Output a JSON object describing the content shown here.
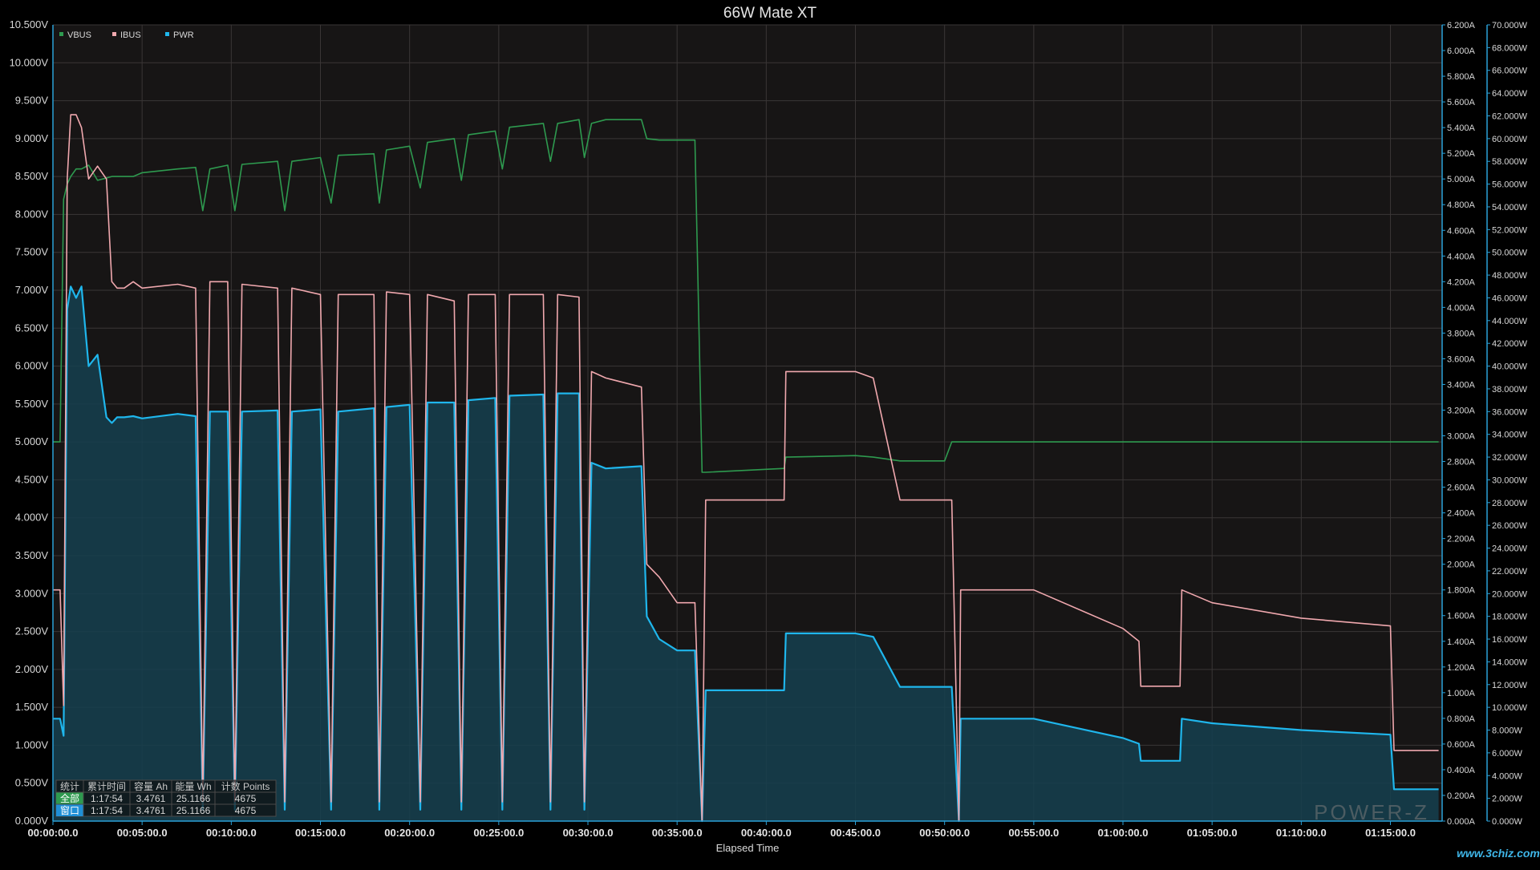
{
  "chart_data": {
    "type": "line",
    "title": "66W Mate XT",
    "xlabel": "Elapsed Time",
    "x_unit": "minutes",
    "xlim": [
      0,
      77.9
    ],
    "x_ticks": [
      0,
      5,
      10,
      15,
      20,
      25,
      30,
      35,
      40,
      45,
      50,
      55,
      60,
      65,
      70,
      75
    ],
    "x_tick_labels": [
      "00:00:00.0",
      "00:05:00.0",
      "00:10:00.0",
      "00:15:00.0",
      "00:20:00.0",
      "00:25:00.0",
      "00:30:00.0",
      "00:35:00.0",
      "00:40:00.0",
      "00:45:00.0",
      "00:50:00.0",
      "00:55:00.0",
      "01:00:00.0",
      "01:05:00.0",
      "01:10:00.0",
      "01:15:00.0"
    ],
    "grid": true,
    "legend_position": "top-left",
    "axes": {
      "voltage": {
        "side": "left",
        "min": 0,
        "max": 10.5,
        "step": 0.5,
        "unit": "V",
        "decimals": 3,
        "tick_labels": [
          "0.000V",
          "0.500V",
          "1.000V",
          "1.500V",
          "2.000V",
          "2.500V",
          "3.000V",
          "3.500V",
          "4.000V",
          "4.500V",
          "5.000V",
          "5.500V",
          "6.000V",
          "6.500V",
          "7.000V",
          "7.500V",
          "8.000V",
          "8.500V",
          "9.000V",
          "9.500V",
          "10.000V",
          "10.500V"
        ]
      },
      "current": {
        "side": "right",
        "min": 0,
        "max": 6.2,
        "step": 0.2,
        "unit": "A",
        "decimals": 3,
        "tick_labels": [
          "0.000A",
          "0.200A",
          "0.400A",
          "0.600A",
          "0.800A",
          "1.000A",
          "1.200A",
          "1.400A",
          "1.600A",
          "1.800A",
          "2.000A",
          "2.200A",
          "2.400A",
          "2.600A",
          "2.800A",
          "3.000A",
          "3.200A",
          "3.400A",
          "3.600A",
          "3.800A",
          "4.000A",
          "4.200A",
          "4.400A",
          "4.600A",
          "4.800A",
          "5.000A",
          "5.200A",
          "5.400A",
          "5.600A",
          "5.800A",
          "6.000A",
          "6.200A"
        ]
      },
      "power": {
        "side": "right",
        "min": 0,
        "max": 70,
        "step": 2,
        "unit": "W",
        "decimals": 3,
        "tick_labels": [
          "0.000W",
          "2.000W",
          "4.000W",
          "6.000W",
          "8.000W",
          "10.000W",
          "12.000W",
          "14.000W",
          "16.000W",
          "18.000W",
          "20.000W",
          "22.000W",
          "24.000W",
          "26.000W",
          "28.000W",
          "30.000W",
          "32.000W",
          "34.000W",
          "36.000W",
          "38.000W",
          "40.000W",
          "42.000W",
          "44.000W",
          "46.000W",
          "48.000W",
          "50.000W",
          "52.000W",
          "54.000W",
          "56.000W",
          "58.000W",
          "60.000W",
          "62.000W",
          "64.000W",
          "66.000W",
          "68.000W",
          "70.000W"
        ]
      }
    },
    "x": [
      0,
      0.4,
      0.6,
      0.8,
      1.0,
      1.3,
      1.6,
      2.0,
      2.5,
      3.0,
      3.3,
      3.6,
      4.0,
      4.5,
      5.0,
      7.0,
      8.0,
      8.4,
      8.8,
      9.8,
      10.2,
      10.6,
      12.6,
      13.0,
      13.4,
      15.0,
      15.6,
      16.0,
      18.0,
      18.3,
      18.7,
      20.0,
      20.6,
      21.0,
      22.5,
      22.9,
      23.3,
      24.8,
      25.2,
      25.6,
      27.5,
      27.9,
      28.3,
      29.5,
      29.8,
      30.2,
      31.0,
      33.0,
      33.3,
      34.0,
      35.0,
      36.0,
      36.4,
      36.6,
      41.0,
      41.1,
      45.0,
      46.0,
      47.5,
      47.6,
      50.0,
      50.4,
      50.8,
      50.9,
      51.1,
      51.4,
      55.0,
      60.0,
      60.9,
      61.0,
      63.2,
      63.3,
      65.0,
      70.0,
      75.0,
      75.2,
      77.7
    ],
    "series": [
      {
        "name": "VBUS",
        "axis": "voltage",
        "color": "#2e9a4f",
        "fill": false,
        "values": [
          5.0,
          5.0,
          8.2,
          8.4,
          8.5,
          8.6,
          8.6,
          8.65,
          8.45,
          8.48,
          8.5,
          8.5,
          8.5,
          8.5,
          8.55,
          8.6,
          8.62,
          8.05,
          8.6,
          8.65,
          8.05,
          8.66,
          8.7,
          8.05,
          8.7,
          8.75,
          8.15,
          8.78,
          8.8,
          8.15,
          8.85,
          8.9,
          8.35,
          8.95,
          9.0,
          8.45,
          9.05,
          9.1,
          8.6,
          9.15,
          9.2,
          8.7,
          9.2,
          9.25,
          8.75,
          9.2,
          9.25,
          9.25,
          9.0,
          8.98,
          8.98,
          8.98,
          4.6,
          4.6,
          4.65,
          4.8,
          4.82,
          4.8,
          4.75,
          4.75,
          4.75,
          5.0,
          5.0,
          5.0,
          5.0,
          5.0,
          5.0,
          5.0,
          5.0,
          5.0,
          5.0,
          5.0,
          5.0,
          5.0,
          5.0,
          5.0,
          5.0
        ]
      },
      {
        "name": "IBUS",
        "axis": "current",
        "color": "#f0a8ae",
        "fill": false,
        "values": [
          1.8,
          1.8,
          0.9,
          5.0,
          5.5,
          5.5,
          5.4,
          5.0,
          5.1,
          5.0,
          4.2,
          4.15,
          4.15,
          4.2,
          4.15,
          4.18,
          4.15,
          0.15,
          4.2,
          4.2,
          0.15,
          4.18,
          4.15,
          0.15,
          4.15,
          4.1,
          0.15,
          4.1,
          4.1,
          0.15,
          4.12,
          4.1,
          0.15,
          4.1,
          4.05,
          0.15,
          4.1,
          4.1,
          0.15,
          4.1,
          4.1,
          0.15,
          4.1,
          4.08,
          0.15,
          3.5,
          3.45,
          3.38,
          2.0,
          1.9,
          1.7,
          1.7,
          0.0,
          2.5,
          2.5,
          3.5,
          3.5,
          3.45,
          2.5,
          2.5,
          2.5,
          2.5,
          0.0,
          1.8,
          1.8,
          1.8,
          1.8,
          1.5,
          1.4,
          1.05,
          1.05,
          1.8,
          1.7,
          1.58,
          1.52,
          0.55,
          0.55
        ]
      },
      {
        "name": "PWR",
        "axis": "power",
        "color": "#1fb6ec",
        "fill": true,
        "values": [
          9.0,
          9.0,
          7.5,
          45.0,
          47.0,
          46.0,
          47.0,
          40.0,
          41.0,
          35.5,
          35.0,
          35.5,
          35.5,
          35.6,
          35.4,
          35.8,
          35.6,
          1.0,
          36.0,
          36.0,
          1.0,
          36.0,
          36.1,
          1.0,
          36.0,
          36.2,
          1.0,
          36.0,
          36.3,
          1.0,
          36.4,
          36.6,
          1.0,
          36.8,
          36.8,
          1.0,
          37.0,
          37.2,
          1.0,
          37.4,
          37.5,
          1.0,
          37.6,
          37.6,
          1.0,
          31.5,
          31.0,
          31.2,
          18.0,
          16.0,
          15.0,
          15.0,
          0.0,
          11.5,
          11.5,
          16.5,
          16.5,
          16.2,
          11.8,
          11.8,
          11.8,
          11.8,
          0.0,
          9.0,
          9.0,
          9.0,
          9.0,
          7.3,
          6.8,
          5.3,
          5.3,
          9.0,
          8.6,
          8.0,
          7.6,
          2.8,
          2.8
        ]
      }
    ],
    "stats_table": {
      "headers": [
        "统计",
        "累计时间",
        "容量 Ah",
        "能量 Wh",
        "计数 Points"
      ],
      "rows": [
        {
          "label": "全部",
          "color": "#2e9a4f",
          "cells": [
            "1:17:54",
            "3.4761",
            "25.1166",
            "4675"
          ]
        },
        {
          "label": "窗口",
          "color": "#1f8fd6",
          "cells": [
            "1:17:54",
            "3.4761",
            "25.1166",
            "4675"
          ]
        }
      ]
    },
    "watermark": "POWER-Z",
    "site_mark": "www.3chiz.com"
  }
}
